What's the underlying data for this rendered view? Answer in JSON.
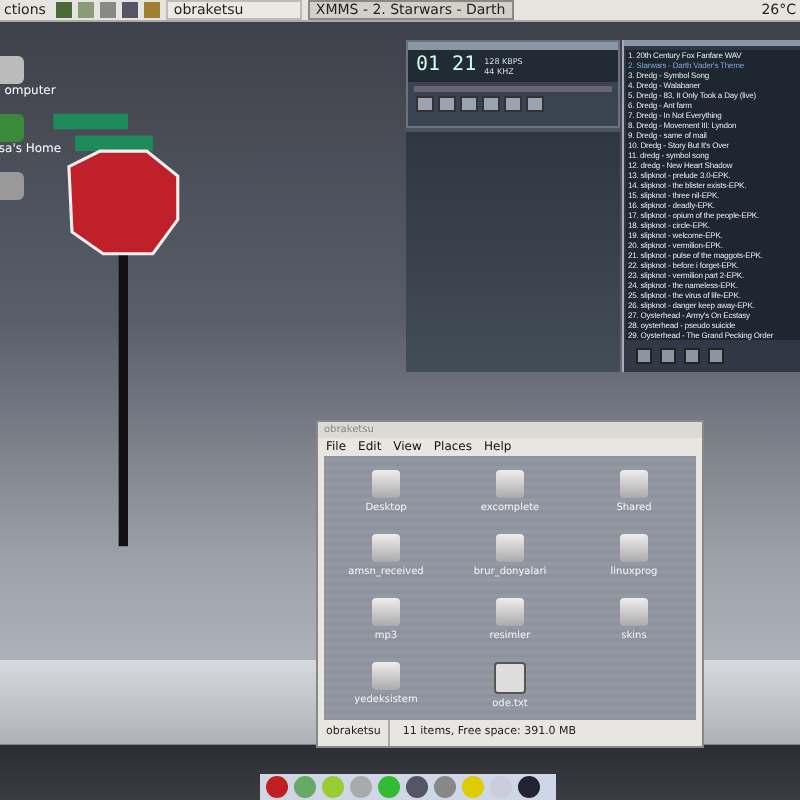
{
  "top_panel": {
    "menu": "ctions",
    "tasks": [
      {
        "label": "obraketsu",
        "selected": false
      },
      {
        "label": "XMMS - 2. Starwars - Darth",
        "selected": true
      }
    ],
    "weather": "26°C"
  },
  "desktop_icons": [
    {
      "label": "omputer"
    },
    {
      "label": "sa's Home"
    }
  ],
  "xmms": {
    "time": "01 21",
    "bitrate": "128 KBPS",
    "samplerate": "44 KHZ"
  },
  "playlist": [
    {
      "label": "1. 20th Century Fox Fanfare WAV",
      "selected": false
    },
    {
      "label": "2. Starwars - Darth Vader's Theme",
      "selected": true
    },
    {
      "label": "3. Dredg - Symbol Song",
      "selected": false
    },
    {
      "label": "4. Dredg - Walabaner",
      "selected": false
    },
    {
      "label": "5. Dredg - 83, It Only Took a Day (live)",
      "selected": false
    },
    {
      "label": "6. Dredg - Ant farm",
      "selected": false
    },
    {
      "label": "7. Dredg - In Not Everything",
      "selected": false
    },
    {
      "label": "8. Dredg - Movement III: Lyndon",
      "selected": false
    },
    {
      "label": "9. Dredg - same of mail",
      "selected": false
    },
    {
      "label": "10. Dredg - Story But It's Over",
      "selected": false
    },
    {
      "label": "11. dredg - symbol song",
      "selected": false
    },
    {
      "label": "12. dredg - New Heart Shadow",
      "selected": false
    },
    {
      "label": "13. slipknot - prelude 3.0-EPK.",
      "selected": false
    },
    {
      "label": "14. slipknot - the blister exists-EPK.",
      "selected": false
    },
    {
      "label": "15. slipknot - three nil-EPK.",
      "selected": false
    },
    {
      "label": "16. slipknot - deadly-EPK.",
      "selected": false
    },
    {
      "label": "17. slipknot - opium of the people-EPK.",
      "selected": false
    },
    {
      "label": "18. slipknot - circle-EPK.",
      "selected": false
    },
    {
      "label": "19. slipknot - welcome-EPK.",
      "selected": false
    },
    {
      "label": "20. slipknot - vermilion-EPK.",
      "selected": false
    },
    {
      "label": "21. slipknot - pulse of the maggots-EPK.",
      "selected": false
    },
    {
      "label": "22. slipknot - before i forget-EPK.",
      "selected": false
    },
    {
      "label": "23. slipknot - vermilion part 2-EPK.",
      "selected": false
    },
    {
      "label": "24. slipknot - the nameless-EPK.",
      "selected": false
    },
    {
      "label": "25. slipknot - the virus of life-EPK.",
      "selected": false
    },
    {
      "label": "26. slipknot - danger keep away-EPK.",
      "selected": false
    },
    {
      "label": "27. Oysterhead - Army's On Ecstasy",
      "selected": false
    },
    {
      "label": "28. oysterhead - pseudo suicide",
      "selected": false
    },
    {
      "label": "29. Oysterhead - The Grand Pecking Order",
      "selected": false
    }
  ],
  "file_manager": {
    "title": "obraketsu",
    "menu": [
      "File",
      "Edit",
      "View",
      "Places",
      "Help"
    ],
    "items": [
      {
        "name": "Desktop",
        "kind": "folder"
      },
      {
        "name": "excomplete",
        "kind": "folder"
      },
      {
        "name": "Shared",
        "kind": "folder"
      },
      {
        "name": "amsn_received",
        "kind": "folder"
      },
      {
        "name": "brur_donyalari",
        "kind": "folder"
      },
      {
        "name": "linuxprog",
        "kind": "folder"
      },
      {
        "name": "mp3",
        "kind": "folder"
      },
      {
        "name": "resimler",
        "kind": "folder"
      },
      {
        "name": "skins",
        "kind": "folder"
      },
      {
        "name": "yedeksistem",
        "kind": "folder"
      },
      {
        "name": "ode.txt",
        "kind": "file"
      }
    ],
    "status_location": "obraketsu",
    "status": "11 items, Free space: 391.0 MB"
  }
}
